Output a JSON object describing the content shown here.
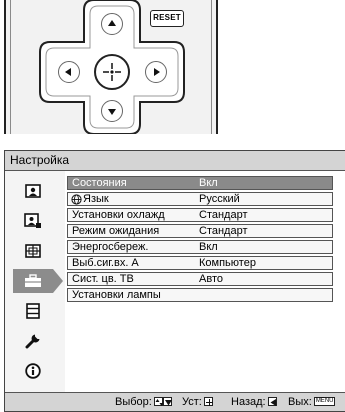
{
  "remote": {
    "reset_label": "RESET",
    "buttons": [
      "up-arrow",
      "down-arrow",
      "left-arrow",
      "right-arrow",
      "enter"
    ]
  },
  "menu": {
    "title": "Настройка",
    "sidebar_icons": [
      {
        "name": "picture-icon",
        "active": false
      },
      {
        "name": "picture-adjust-icon",
        "active": false
      },
      {
        "name": "screen-icon",
        "active": false
      },
      {
        "name": "setup-briefcase-icon",
        "active": true
      },
      {
        "name": "menu-list-icon",
        "active": false
      },
      {
        "name": "wrench-icon",
        "active": false
      },
      {
        "name": "info-icon",
        "active": false
      }
    ],
    "rows": [
      {
        "label": "Состояния",
        "value": "Вкл",
        "selected": true
      },
      {
        "label": "Язык",
        "value": "Русский",
        "icon": "globe-icon"
      },
      {
        "label": "Установки охлажд",
        "value": "Стандарт"
      },
      {
        "label": "Режим ожидания",
        "value": "Стандарт"
      },
      {
        "label": "Энергосбереж.",
        "value": "Вкл"
      },
      {
        "label": "Выб.сиг.вх. A",
        "value": "Компьютер"
      },
      {
        "label": "Сист. цв. ТВ",
        "value": "Авто"
      },
      {
        "label": "Установки лампы",
        "value": ""
      }
    ],
    "footer": {
      "select_label": "Выбор:",
      "set_label": "Уст:",
      "back_label": "Назад:",
      "exit_label": "Вых:",
      "menu_key": "MENU"
    },
    "colors": {
      "title_bar": "#d4d4d4",
      "selected_row": "#8a8a8a",
      "active_tab": "#8c8c8c"
    }
  }
}
